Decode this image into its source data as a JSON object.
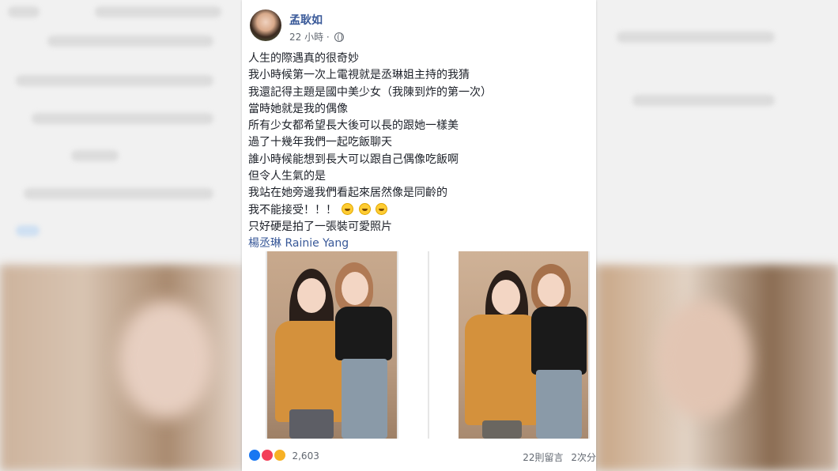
{
  "post": {
    "author": "孟耿如",
    "time": "22 小時",
    "lines": [
      "人生的際遇真的很奇妙",
      "我小時候第一次上電視就是丞琳姐主持的我猜",
      "我還記得主題是國中美少女（我陳到炸的第一次）",
      "當時她就是我的偶像",
      "所有少女都希望長大後可以長的跟她一樣美",
      "過了十幾年我們一起吃飯聊天",
      "誰小時候能想到長大可以跟自己偶像吃飯啊",
      "但令人生氣的是",
      "我站在她旁邊我們看起來居然像是同齡的",
      "我不能接受！！！",
      "只好硬是拍了一張裝可愛照片"
    ],
    "tag": "楊丞琳 Rainie Yang"
  },
  "footer": {
    "reaction_count": "2,603",
    "comments": "22則留言",
    "shares": "2次分"
  },
  "icons": {
    "avatar": "profile-avatar",
    "privacy": "globe-icon",
    "reactions": [
      "like-icon",
      "love-icon",
      "haha-icon"
    ],
    "inline_emoji": "laughing-emoji"
  },
  "colors": {
    "link": "#385898",
    "text": "#1d2129",
    "meta": "#616770",
    "like": "#1877f2",
    "love": "#f33e58",
    "haha": "#f7b125"
  }
}
